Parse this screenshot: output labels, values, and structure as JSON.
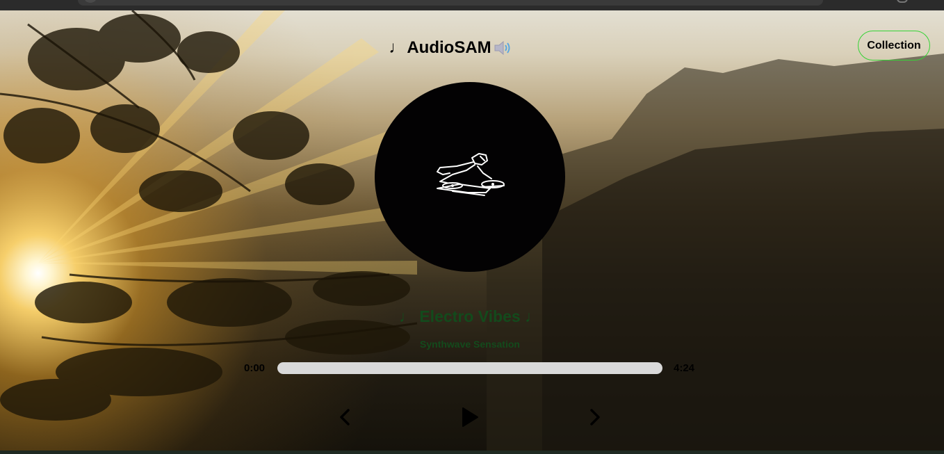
{
  "app": {
    "title_prefix": "♩",
    "title": "AudioSAM",
    "title_icon": "speaker-icon"
  },
  "nav": {
    "collection_label": "Collection"
  },
  "player": {
    "album_art_icon": "dj-turntable-icon",
    "song_title": "♩ Electro Vibes ♩",
    "artist": "Synthwave Sensation",
    "current_time": "0:00",
    "total_time": "4:24",
    "progress": 0,
    "controls": {
      "previous_icon": "chevron-left-icon",
      "play_icon": "play-icon",
      "next_icon": "chevron-right-icon"
    }
  },
  "colors": {
    "song_text": "#134a1c",
    "collection_border": "#35d335",
    "progress_track": "#d9d9d9"
  }
}
